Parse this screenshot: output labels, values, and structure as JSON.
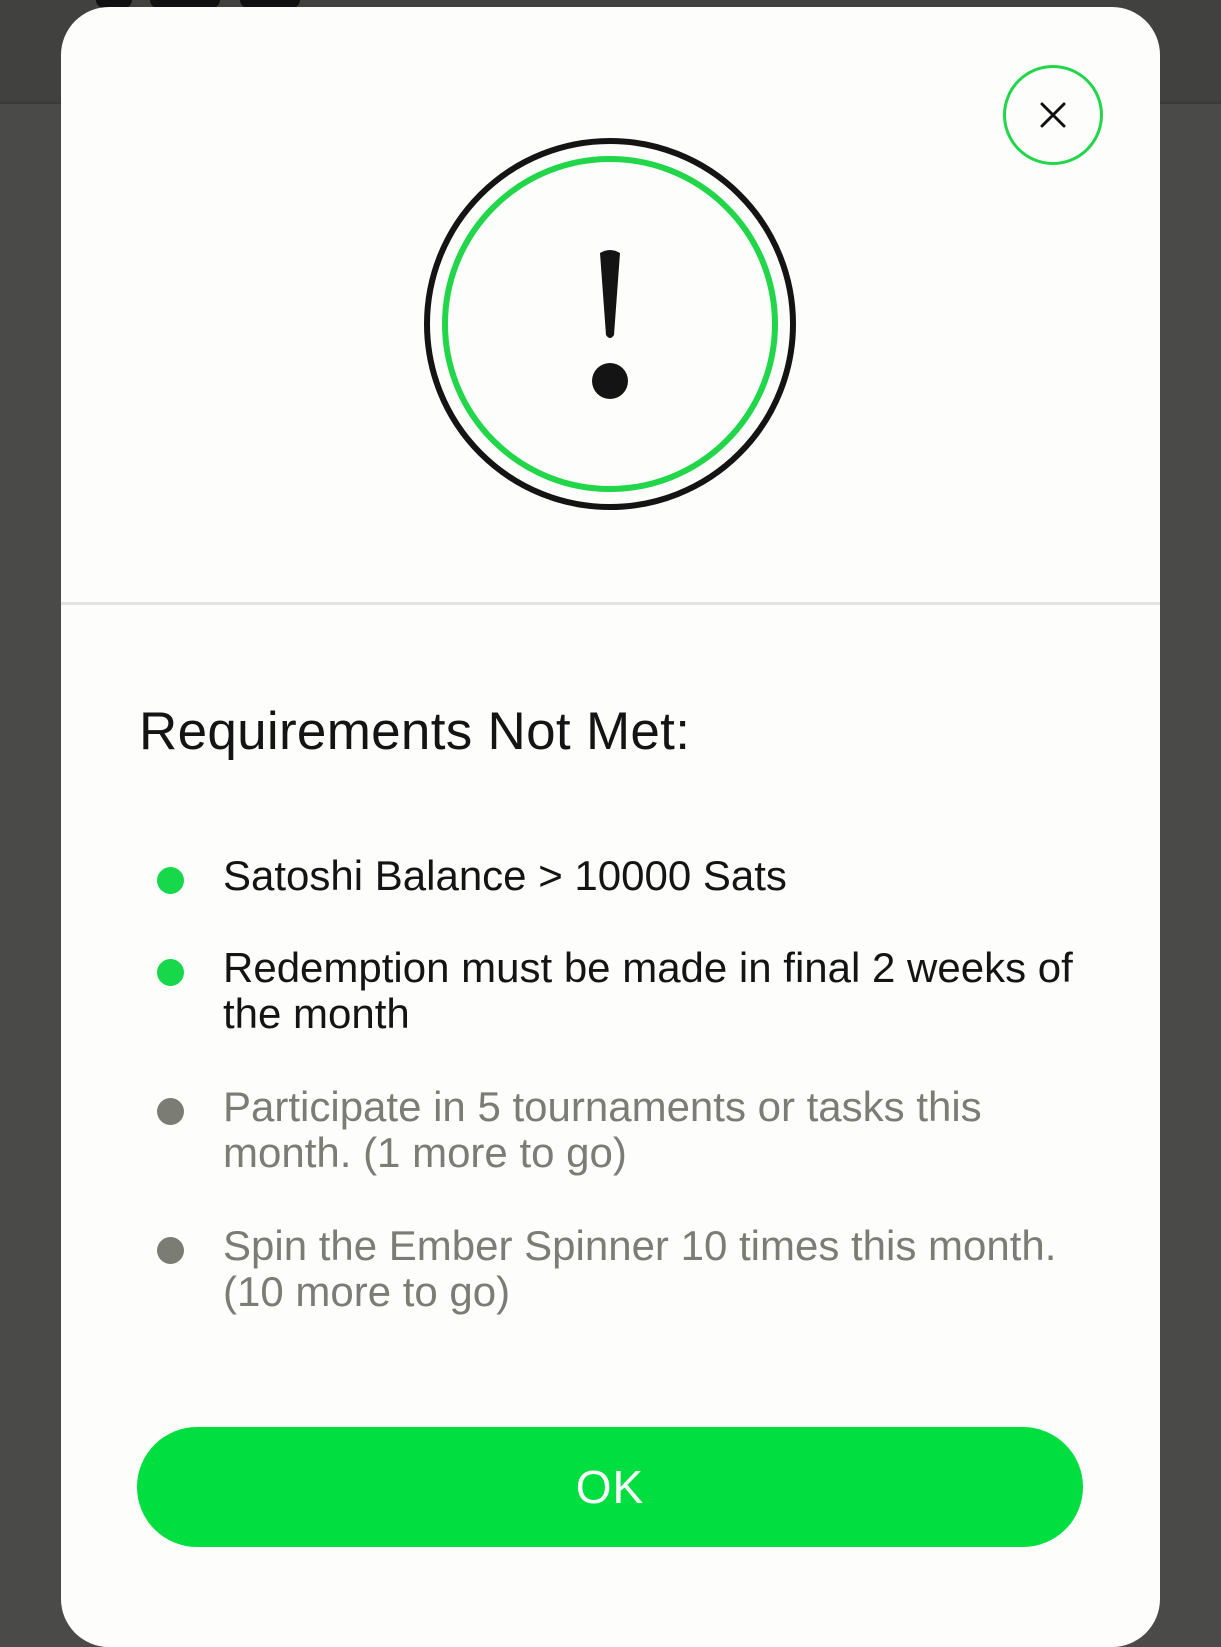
{
  "colors": {
    "accent": "#00df3f",
    "ring_outer": "#141414",
    "ring_inner": "#22d64a",
    "met_bullet": "#16d84a",
    "unmet_text": "#7b7c74",
    "modal_bg": "#fdfdfb",
    "backdrop": "#4a4a48"
  },
  "dialog": {
    "close_icon": "close-icon",
    "alert_icon": "exclamation-icon",
    "title": "Requirements Not Met:",
    "requirements": [
      {
        "text": "Satoshi Balance > 10000 Sats",
        "met": true
      },
      {
        "text": "Redemption must be made in final 2 weeks of the month",
        "met": true
      },
      {
        "text": "Participate in 5 tournaments or tasks this month. (1 more to go)",
        "met": false
      },
      {
        "text": "Spin the Ember Spinner 10 times this month. (10 more to go)",
        "met": false
      }
    ],
    "ok_label": "OK"
  }
}
